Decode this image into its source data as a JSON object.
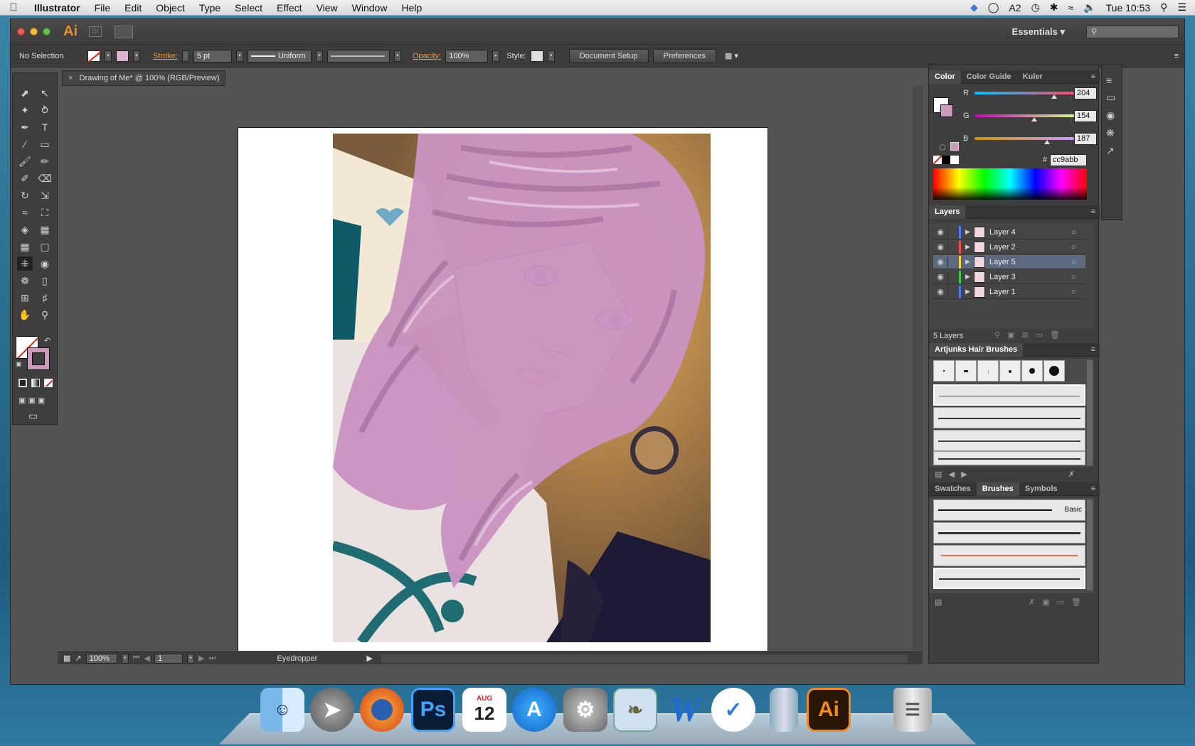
{
  "menubar": {
    "apple": "",
    "items": [
      "Illustrator",
      "File",
      "Edit",
      "Object",
      "Type",
      "Select",
      "Effect",
      "View",
      "Window",
      "Help"
    ],
    "clock": "Tue 10:53",
    "adobe_count": "2"
  },
  "titlebar": {
    "ai_logo": "Ai",
    "br_logo": "Br",
    "workspace": "Essentials"
  },
  "controlbar": {
    "selection": "No Selection",
    "stroke_label": "Stroke:",
    "stroke_value": "5 pt",
    "profile": "Uniform",
    "opacity_label": "Opacity:",
    "opacity_value": "100%",
    "style_label": "Style:",
    "doc_setup": "Document Setup",
    "preferences": "Preferences"
  },
  "document": {
    "tab_title": "Drawing of Me* @ 100% (RGB/Preview)"
  },
  "statusbar": {
    "zoom": "100%",
    "artboard": "1",
    "tool": "Eyedropper"
  },
  "color_panel": {
    "tabs": [
      "Color",
      "Color Guide",
      "Kuler"
    ],
    "r_label": "R",
    "r_value": "204",
    "r_level": 0.8,
    "g_label": "G",
    "g_value": "154",
    "g_level": 0.6,
    "b_label": "B",
    "b_value": "187",
    "b_level": 0.73,
    "hex_label": "#",
    "hex_value": "cc9abb",
    "fill_color": "#cc9abb"
  },
  "layers_panel": {
    "title": "Layers",
    "layers": [
      {
        "name": "Layer 4",
        "color": "#4a7cff",
        "selected": false
      },
      {
        "name": "Layer 2",
        "color": "#ff4a4a",
        "selected": false
      },
      {
        "name": "Layer 5",
        "color": "#ffd23a",
        "selected": true
      },
      {
        "name": "Layer 3",
        "color": "#33cc44",
        "selected": false
      },
      {
        "name": "Layer 1",
        "color": "#4a7cff",
        "selected": false
      }
    ],
    "count": "5 Layers"
  },
  "hair_brushes": {
    "title": "Artjunks Hair Brushes"
  },
  "brushes_panel": {
    "tabs": [
      "Swatches",
      "Brushes",
      "Symbols"
    ],
    "basic_label": "Basic"
  },
  "dock": {
    "apps": [
      "Finder",
      "Launchpad",
      "Firefox",
      "Photoshop",
      "Calendar",
      "App Store",
      "System Preferences",
      "Preview",
      "Word",
      "Wunderlist",
      "Archive",
      "Illustrator",
      "Trash"
    ],
    "ps_label": "Ps",
    "ai_label": "Ai",
    "w_label": "W",
    "cal_month": "AUG",
    "cal_day": "12"
  }
}
